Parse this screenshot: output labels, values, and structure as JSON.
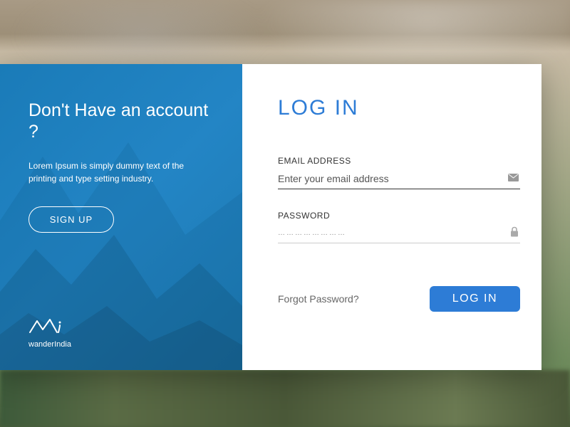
{
  "signup": {
    "title": "Don't Have an account ?",
    "description": "Lorem Ipsum is simply dummy text of the printing and type setting industry.",
    "button_label": "SIGN UP",
    "brand_name": "wanderIndia"
  },
  "login": {
    "title": "LOG IN",
    "email_label": "EMAIL ADDRESS",
    "email_placeholder": "Enter your email address",
    "email_value": "",
    "password_label": "PASSWORD",
    "password_masked": "……………………",
    "forgot_label": "Forgot Password?",
    "submit_label": "LOG IN"
  },
  "colors": {
    "primary_blue": "#2d7cd6",
    "panel_blue": "#1a7bb8"
  }
}
